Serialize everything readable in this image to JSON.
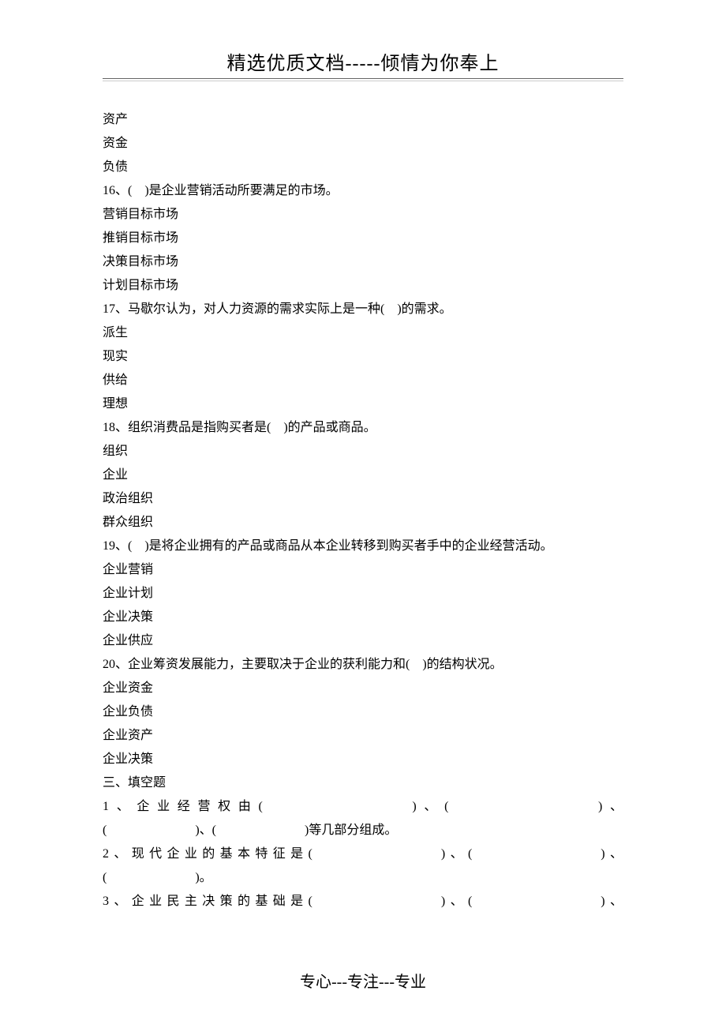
{
  "header": "精选优质文档-----倾情为你奉上",
  "footer": "专心---专注---专业",
  "lines": [
    {
      "text": "资产"
    },
    {
      "text": "资金"
    },
    {
      "text": "负债"
    },
    {
      "text": "16、(　)是企业营销活动所要满足的市场。"
    },
    {
      "text": "营销目标市场"
    },
    {
      "text": "推销目标市场"
    },
    {
      "text": "决策目标市场"
    },
    {
      "text": "计划目标市场"
    },
    {
      "text": "17、马歇尔认为，对人力资源的需求实际上是一种(　)的需求。"
    },
    {
      "text": "派生"
    },
    {
      "text": "现实"
    },
    {
      "text": "供给"
    },
    {
      "text": "理想"
    },
    {
      "text": "18、组织消费品是指购买者是(　)的产品或商品。"
    },
    {
      "text": "组织"
    },
    {
      "text": "企业"
    },
    {
      "text": "政治组织"
    },
    {
      "text": "群众组织"
    },
    {
      "text": "19、(　)是将企业拥有的产品或商品从本企业转移到购买者手中的企业经营活动。"
    },
    {
      "text": "企业营销"
    },
    {
      "text": "企业计划"
    },
    {
      "text": "企业决策"
    },
    {
      "text": "企业供应"
    },
    {
      "text": "20、企业筹资发展能力，主要取决于企业的获利能力和(　)的结构状况。"
    },
    {
      "text": "企业资金"
    },
    {
      "text": "企业负债"
    },
    {
      "text": "企业资产"
    },
    {
      "text": "企业决策"
    },
    {
      "text": "三、填空题"
    },
    {
      "text": "1、企业经营权由(　　　　　　　)、(　　　　　　　)、",
      "justify": true
    },
    {
      "text": "(　　　　　　　)、(　　　　　　　)等几部分组成。"
    },
    {
      "text": "2、现代企业的基本特征是(　　　　　　　)、(　　　　　　　)、",
      "justify": true
    },
    {
      "text": "(　　　　　　　)。"
    },
    {
      "text": "3、企业民主决策的基础是(　　　　　　　)、(　　　　　　　)、",
      "justify": true
    }
  ]
}
